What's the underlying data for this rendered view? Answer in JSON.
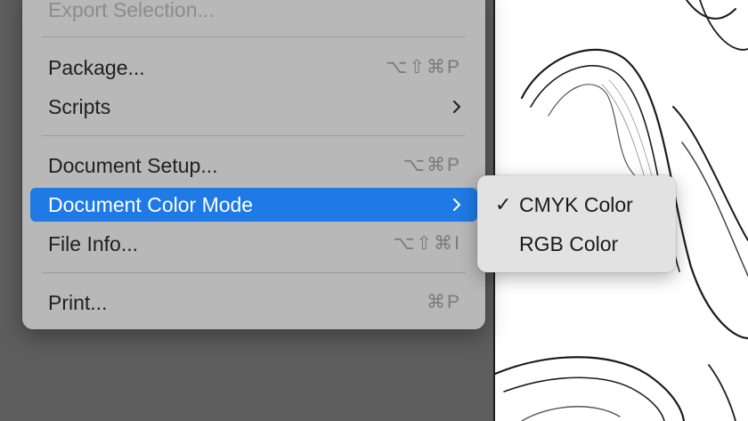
{
  "file_menu": {
    "items": [
      {
        "label": "Export Selection...",
        "shortcut": "",
        "disabled": true
      },
      {
        "label": "Package...",
        "shortcut": "⌥⇧⌘P"
      },
      {
        "label": "Scripts",
        "submenu": true
      },
      {
        "label": "Document Setup...",
        "shortcut": "⌥⌘P"
      },
      {
        "label": "Document Color Mode",
        "submenu": true,
        "highlighted": true
      },
      {
        "label": "File Info...",
        "shortcut": "⌥⇧⌘I"
      },
      {
        "label": "Print...",
        "shortcut": "⌘P"
      }
    ]
  },
  "color_mode_submenu": {
    "items": [
      {
        "label": "CMYK Color",
        "checked": true,
        "check_mark": "✓"
      },
      {
        "label": "RGB Color",
        "checked": false
      }
    ]
  },
  "colors": {
    "highlight": "#1f7ae5",
    "menu_bg": "#b9b8b8",
    "submenu_bg": "#e3e2e2"
  }
}
